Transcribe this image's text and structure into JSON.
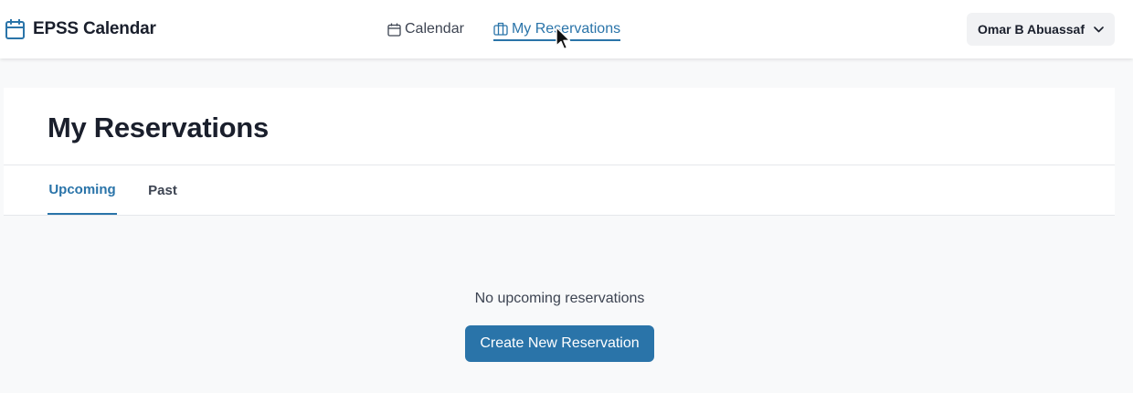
{
  "navbar": {
    "brand": "EPSS Calendar",
    "brand_icon": "calendar-icon",
    "links": [
      {
        "label": "Calendar",
        "icon": "calendar-icon"
      },
      {
        "label": "My Reservations",
        "icon": "briefcase-icon",
        "active": true
      }
    ],
    "user": {
      "name": "Omar B Abuassaf",
      "icon": "chevron-down-icon"
    }
  },
  "page": {
    "title": "My Reservations",
    "tabs": [
      {
        "label": "Upcoming",
        "active": true
      },
      {
        "label": "Past"
      }
    ]
  },
  "empty_state": {
    "message": "No upcoming reservations",
    "action_label": "Create New Reservation"
  },
  "colors": {
    "accent": "#2a74a9",
    "text": "#1a1f2c",
    "muted_text": "#3d4452",
    "page_background": "#f8f9fa"
  }
}
